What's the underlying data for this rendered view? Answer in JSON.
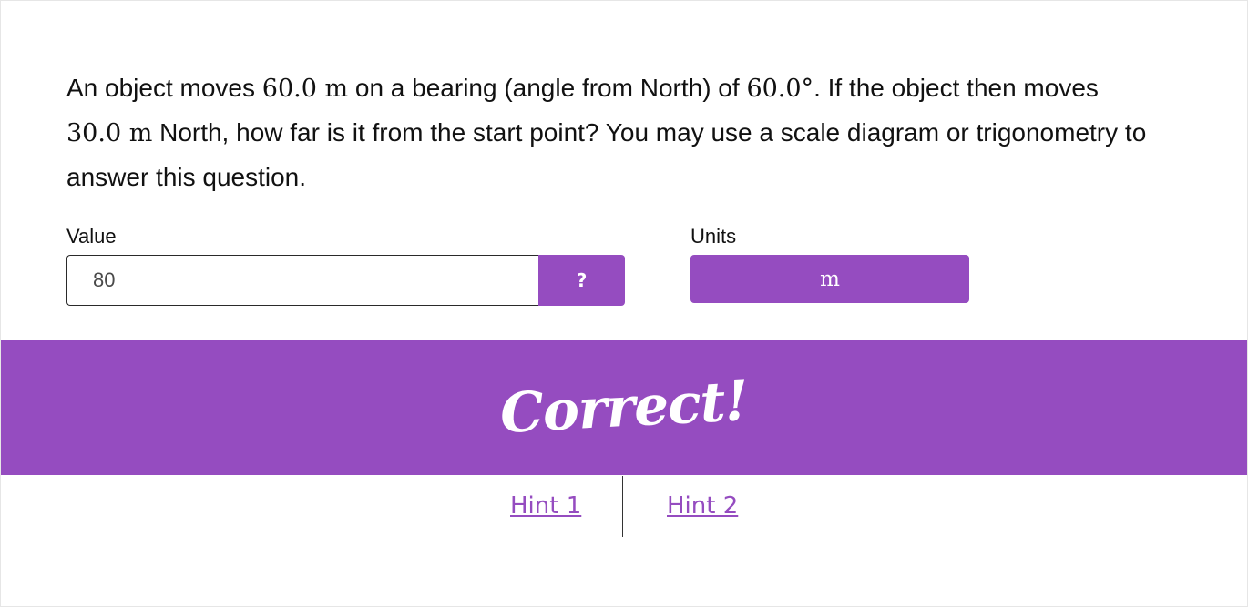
{
  "question": {
    "part1": "An object moves ",
    "math1": "60.0 m",
    "part2": " on a bearing (angle from North) of ",
    "math2": "60.0°",
    "part3": ". If the object then moves ",
    "math3": "30.0 m",
    "part4": " North, how far is it from the start point? You may use a scale diagram or trigonometry to answer this question."
  },
  "answer": {
    "value_label": "Value",
    "value": "80",
    "help_label": "?",
    "units_label": "Units",
    "units_value": "m"
  },
  "feedback": {
    "text": "Correct!"
  },
  "hints": [
    "Hint 1",
    "Hint 2"
  ],
  "colors": {
    "accent": "#954cc0"
  }
}
